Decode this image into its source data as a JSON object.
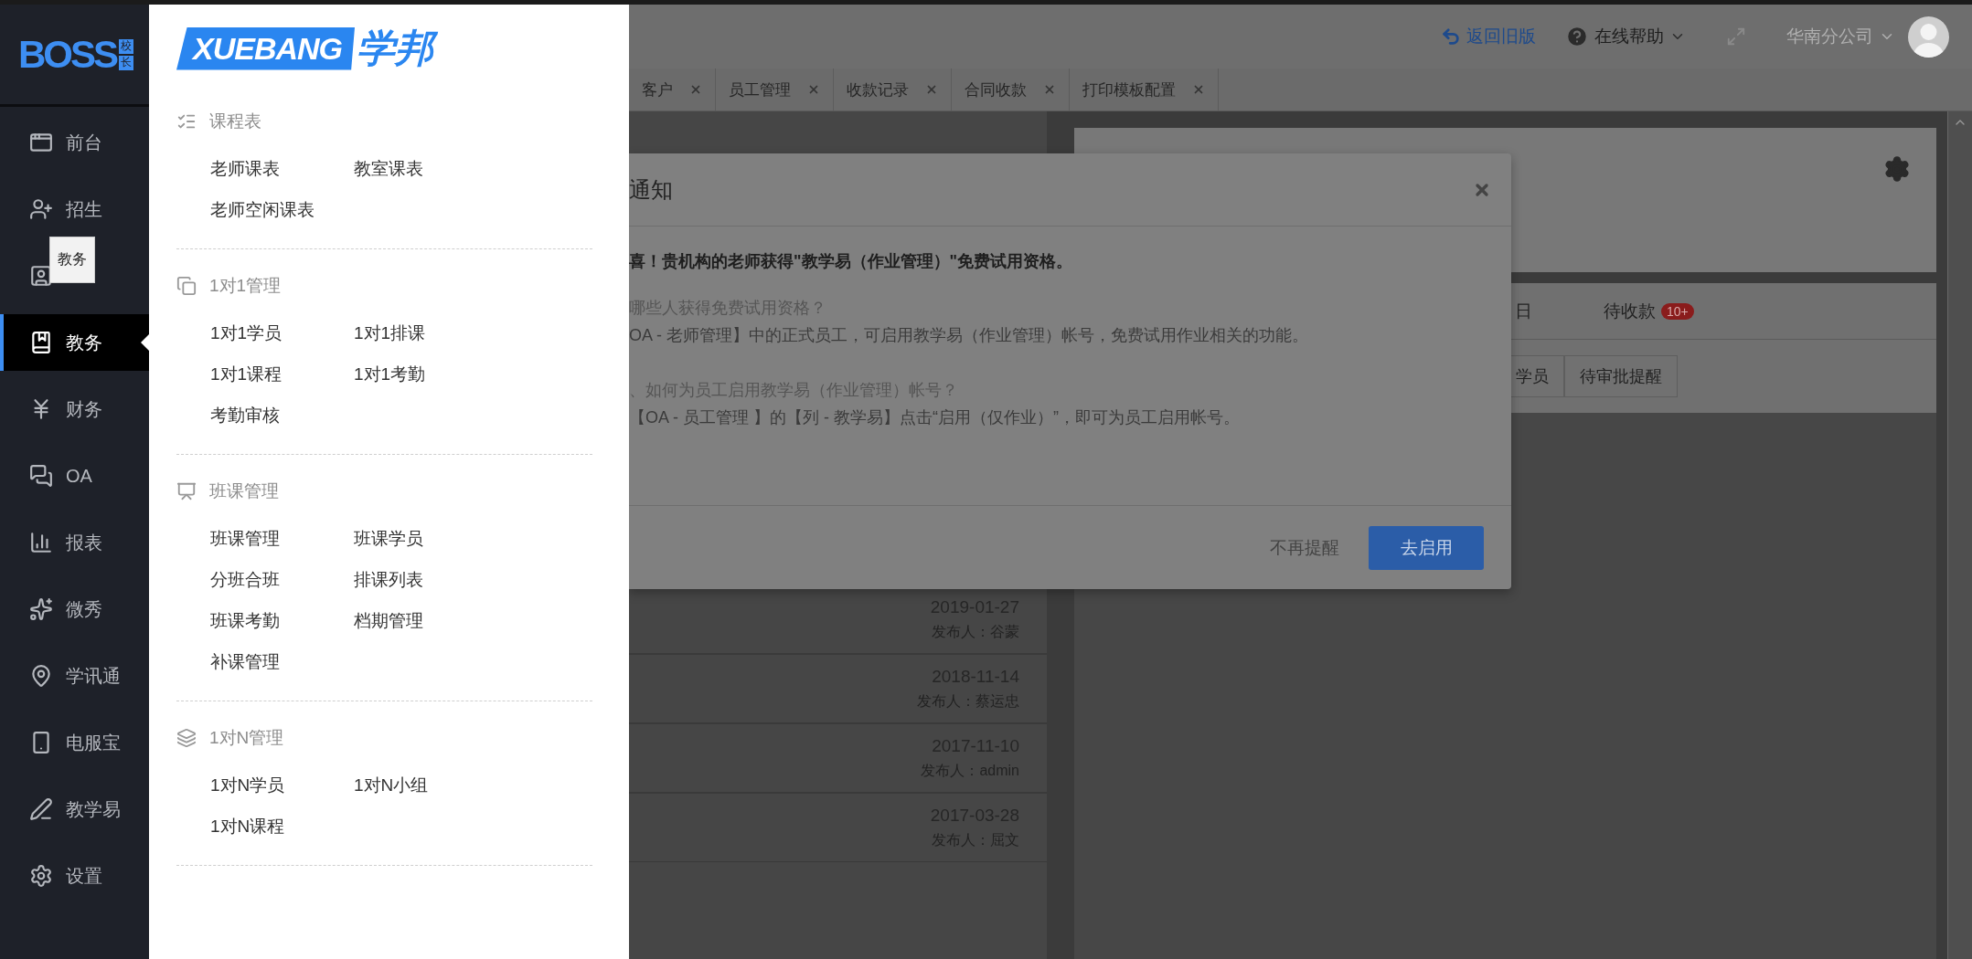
{
  "sidebar": {
    "logo": {
      "text": "BOSS",
      "badge": [
        "校",
        "长"
      ]
    },
    "items": [
      {
        "label": "前台",
        "selected": false
      },
      {
        "label": "招生",
        "selected": false
      },
      {
        "selected": false
      },
      {
        "label": "教务",
        "selected": true
      },
      {
        "label": "财务",
        "selected": false
      },
      {
        "label": "OA",
        "selected": false
      },
      {
        "label": "报表",
        "selected": false
      },
      {
        "label": "微秀",
        "selected": false
      },
      {
        "label": "学讯通",
        "selected": false
      },
      {
        "label": "电服宝",
        "selected": false
      },
      {
        "label": "教学易",
        "selected": false
      },
      {
        "label": "设置",
        "selected": false
      }
    ],
    "tooltip": "教务"
  },
  "flyout": {
    "logo": {
      "latin": "XUEBANG",
      "chinese": "学邦"
    },
    "sections": [
      {
        "title": "课程表",
        "items": [
          "老师课表",
          "教室课表",
          "老师空闲课表"
        ]
      },
      {
        "title": "1对1管理",
        "items": [
          "1对1学员",
          "1对1排课",
          "1对1课程",
          "1对1考勤",
          "考勤审核"
        ]
      },
      {
        "title": "班课管理",
        "items": [
          "班课管理",
          "班课学员",
          "分班合班",
          "排课列表",
          "班课考勤",
          "档期管理",
          "补课管理"
        ]
      },
      {
        "title": "1对N管理",
        "items": [
          "1对N学员",
          "1对N小组",
          "1对N课程"
        ]
      }
    ]
  },
  "topbar": {
    "back": "返回旧版",
    "help": "在线帮助",
    "branch": "华南分公司"
  },
  "tabs": [
    "客户",
    "员工管理",
    "收款记录",
    "合同收款",
    "打印模板配置"
  ],
  "notices": [
    {
      "date": "2019-01-27",
      "publisher": "发布人：谷蒙"
    },
    {
      "date": "2018-11-14",
      "publisher": "发布人：蔡运忠"
    },
    {
      "date": "2017-11-10",
      "publisher": "发布人：admin"
    },
    {
      "date": "2017-03-28",
      "publisher": "发布人：屈文"
    }
  ],
  "panel": {
    "tabs": [
      {
        "label": "日"
      },
      {
        "label": "待收款",
        "badge": "10+"
      }
    ],
    "buttons": [
      "学员",
      "待审批提醒"
    ]
  },
  "modal": {
    "title": "通知",
    "headline": "喜！贵机构的老师获得\"教学易（作业管理）\"免费试用资格。",
    "paragraphs": [
      {
        "kind": "question",
        "text": "哪些人获得免费试用资格？"
      },
      {
        "kind": "answer",
        "text": "OA - 老师管理】中的正式员工，可启用教学易（作业管理）帐号，免费试用作业相关的功能。"
      },
      {
        "kind": "gap"
      },
      {
        "kind": "question",
        "text": "、如何为员工启用教学易（作业管理）帐号？"
      },
      {
        "kind": "answer",
        "text": "【OA - 员工管理 】的【列 - 教学易】点击“启用（仅作业）”，即可为员工启用帐号。"
      }
    ],
    "dismiss": "不再提醒",
    "confirm": "去启用"
  }
}
